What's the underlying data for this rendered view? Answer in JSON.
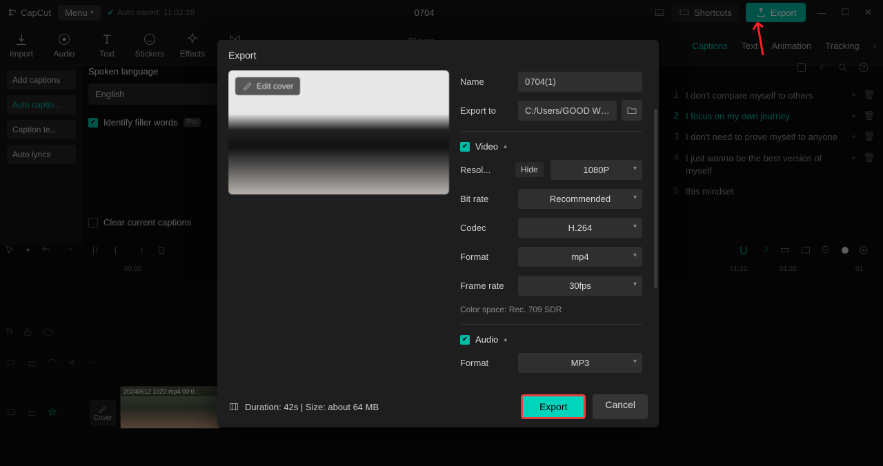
{
  "app": {
    "name": "CapCut",
    "menu": "Menu",
    "autosave": "Auto saved: 11:02:28",
    "project": "0704"
  },
  "topbar": {
    "shortcuts": "Shortcuts",
    "export": "Export"
  },
  "toolbar": {
    "import": "Import",
    "audio": "Audio",
    "text": "Text",
    "stickers": "Stickers",
    "effects": "Effects",
    "transitions": "Trans..."
  },
  "sidebar": {
    "add_captions": "Add captions",
    "auto_captions": "Auto captio...",
    "caption_templates": "Caption te...",
    "auto_lyrics": "Auto lyrics"
  },
  "lang_panel": {
    "header": "Spoken language",
    "language": "English",
    "identify_filler": "Identify filler words",
    "pro": "Pro",
    "clear_captions": "Clear current captions"
  },
  "right": {
    "tabs": {
      "captions": "Captions",
      "text": "Text",
      "animation": "Animation",
      "tracking": "Tracking"
    },
    "list": [
      {
        "idx": "1",
        "text": "I don't compare myself to others"
      },
      {
        "idx": "2",
        "text": "I focus on my own journey"
      },
      {
        "idx": "3",
        "text": "I don't need to prove myself to anyone"
      },
      {
        "idx": "4",
        "text": "I just wanna be the best version of myself"
      },
      {
        "idx": "5",
        "text": "this mindset"
      }
    ]
  },
  "timeline": {
    "ruler": [
      "00:00",
      "01:10",
      "01:20",
      "01:"
    ],
    "cover_btn": "Cover",
    "clip_label": "20240612 1027.mp4   00:0..."
  },
  "modal": {
    "title": "Export",
    "edit_cover": "Edit cover",
    "name_label": "Name",
    "name_value": "0704(1)",
    "export_to_label": "Export to",
    "export_to_value": "C:/Users/GOOD WILL ...",
    "video_section": "Video",
    "resolution_label": "Resol...",
    "hide": "Hide",
    "resolution_value": "1080P",
    "bitrate_label": "Bit rate",
    "bitrate_value": "Recommended",
    "codec_label": "Codec",
    "codec_value": "H.264",
    "format_label": "Format",
    "format_value": "mp4",
    "framerate_label": "Frame rate",
    "framerate_value": "30fps",
    "colorspace": "Color space: Rec. 709 SDR",
    "audio_section": "Audio",
    "audio_format_label": "Format",
    "audio_format_value": "MP3",
    "duration": "Duration: 42s | Size: about 64 MB",
    "export_btn": "Export",
    "cancel_btn": "Cancel"
  },
  "player_label": "Player"
}
